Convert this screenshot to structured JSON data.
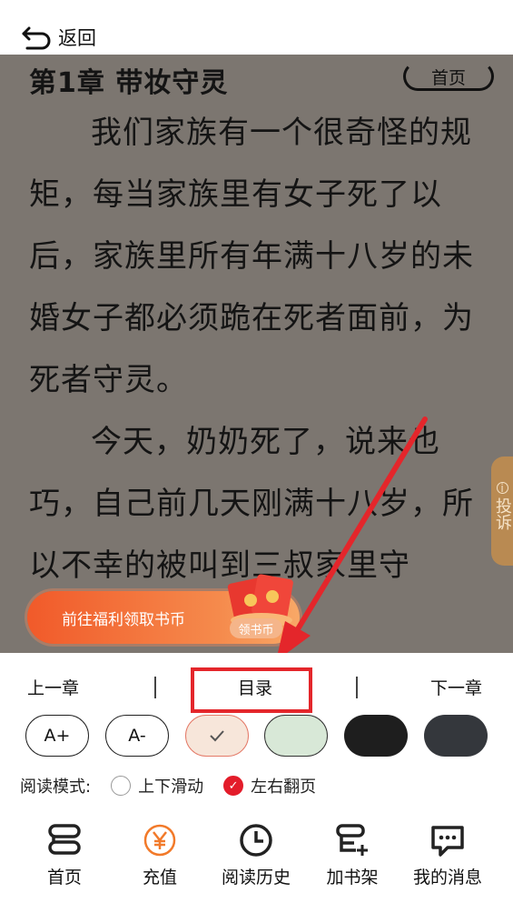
{
  "topbar": {
    "back_label": "返回"
  },
  "reader": {
    "chapter_title": "第1章 带妆守灵",
    "home_label": "首页",
    "paragraphs": [
      "我们家族有一个很奇怪的规矩，每当家族里有女子死了以后，家族里所有年满十八岁的未婚女子都必须跪在死者面前，为死者守灵。",
      "今天，奶奶死了，说来也巧，自己前几天刚满十八岁，所以不幸的被叫到三叔家里守"
    ],
    "report_tab": "投诉",
    "promo_label": "前往福利领取书币",
    "coin_badge": "领书币"
  },
  "controls": {
    "prev_chapter": "上一章",
    "toc": "目录",
    "next_chapter": "下一章",
    "font_increase": "A+",
    "font_decrease": "A-",
    "read_mode_label": "阅读模式:",
    "mode_scroll": "上下滑动",
    "mode_page": "左右翻页"
  },
  "tabbar": {
    "items": [
      {
        "label": "首页",
        "icon": "bookshelf-icon"
      },
      {
        "label": "充值",
        "icon": "yen-coin-icon"
      },
      {
        "label": "阅读历史",
        "icon": "clock-icon"
      },
      {
        "label": "加书架",
        "icon": "add-shelf-icon"
      },
      {
        "label": "我的消息",
        "icon": "message-icon"
      }
    ]
  },
  "colors": {
    "accent": "#e31c2a",
    "recharge": "#f27a2a",
    "reader_bg": "#7c7670"
  }
}
